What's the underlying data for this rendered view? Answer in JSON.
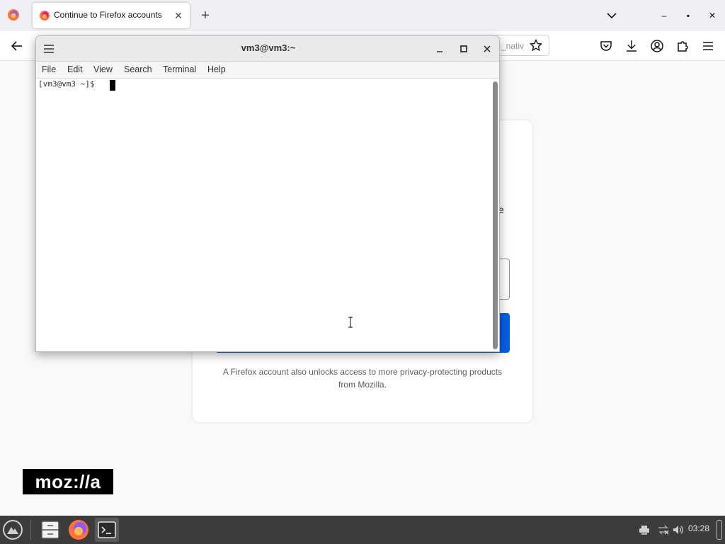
{
  "browser": {
    "tab": {
      "title": "Continue to Firefox accounts",
      "close_glyph": "✕"
    },
    "new_tab_glyph": "+",
    "window_controls": {
      "minimize": "–",
      "maximize": "▪",
      "close": "✕"
    },
    "url_fragment": "_nativ",
    "icons": [
      "firefox-menu-icon",
      "back-icon",
      "star-icon",
      "pocket-icon",
      "download-icon",
      "account-icon",
      "extensions-icon",
      "hamburger-menu-icon",
      "list-tabs-icon"
    ]
  },
  "page": {
    "card_fragment": "e",
    "promo_text": "A Firefox account also unlocks access to more privacy-protecting products from Mozilla.",
    "logo_text": "moz://a",
    "colors": {
      "primary_button": "#0060df"
    }
  },
  "terminal": {
    "title": "vm3@vm3:~",
    "menu": [
      "File",
      "Edit",
      "View",
      "Search",
      "Terminal",
      "Help"
    ],
    "prompt": "[vm3@vm3 ~]$ "
  },
  "taskbar": {
    "apps": [
      "launcher-icon",
      "file-manager-icon",
      "firefox-icon",
      "terminal-icon"
    ],
    "tray": [
      "printer-icon",
      "network-icon",
      "volume-icon"
    ],
    "clock": "03:28"
  }
}
